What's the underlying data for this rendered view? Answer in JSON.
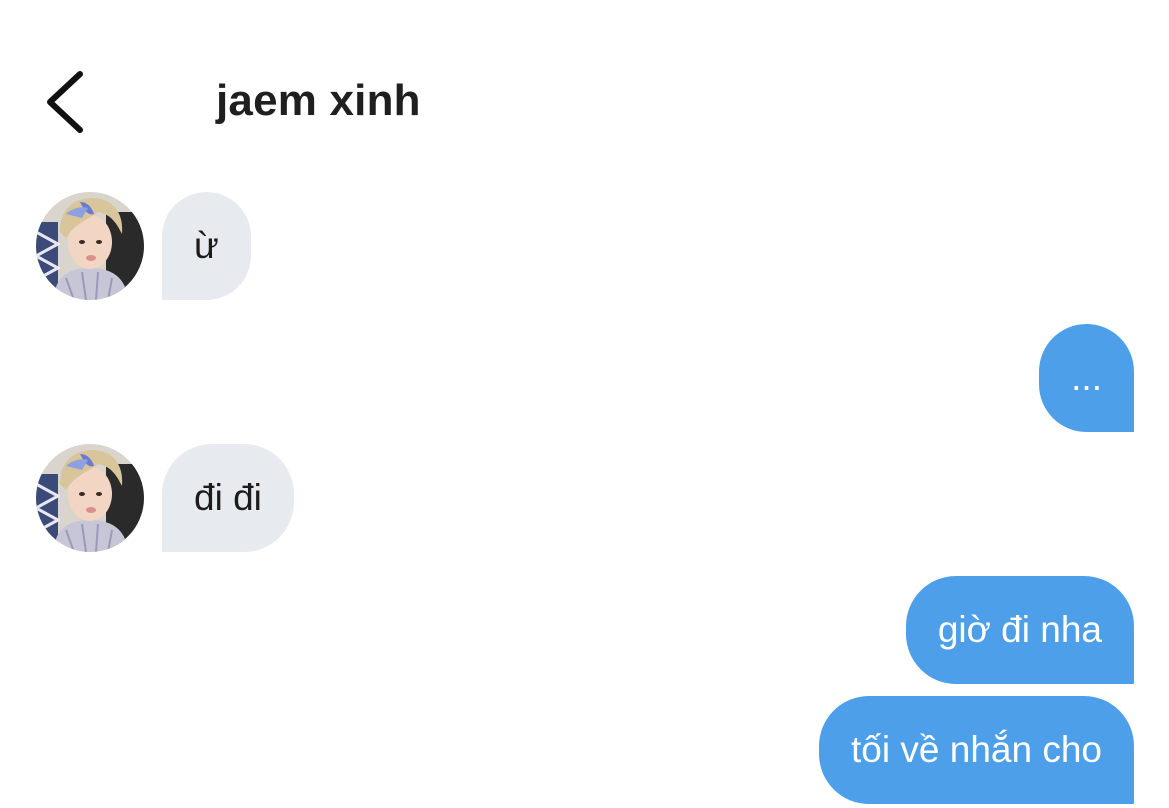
{
  "header": {
    "title": "jaem xinh",
    "back_icon": "chevron-left-icon"
  },
  "contact": {
    "avatar_icon": "avatar-photo"
  },
  "colors": {
    "incoming_bubble": "#e7ebef",
    "outgoing_bubble": "#4e9fe9",
    "outgoing_text": "#ffffff",
    "incoming_text": "#1c1c1c"
  },
  "messages": [
    {
      "direction": "incoming",
      "text": "ừ"
    },
    {
      "direction": "outgoing",
      "text": "..."
    },
    {
      "direction": "incoming",
      "text": "đi đi"
    },
    {
      "direction": "outgoing",
      "text": "giờ đi nha"
    },
    {
      "direction": "outgoing",
      "text": "tối về nhắn cho"
    }
  ]
}
